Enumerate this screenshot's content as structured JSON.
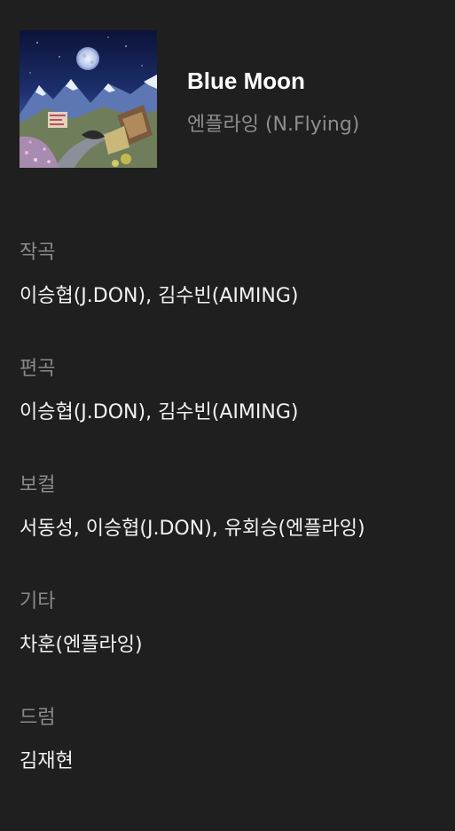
{
  "track": {
    "title": "Blue Moon",
    "artist": "엔플라잉 (N.Flying)"
  },
  "credits": [
    {
      "role": "작곡",
      "names": "이승협(J.DON), 김수빈(AIMING)"
    },
    {
      "role": "편곡",
      "names": "이승협(J.DON), 김수빈(AIMING)"
    },
    {
      "role": "보컬",
      "names": "서동성, 이승협(J.DON), 유회승(엔플라잉)"
    },
    {
      "role": "기타",
      "names": "차훈(엔플라잉)"
    },
    {
      "role": "드럼",
      "names": "김재현"
    }
  ],
  "colors": {
    "background": "#1f1f1f",
    "title": "#ffffff",
    "secondary_text": "#8e8e8e"
  }
}
